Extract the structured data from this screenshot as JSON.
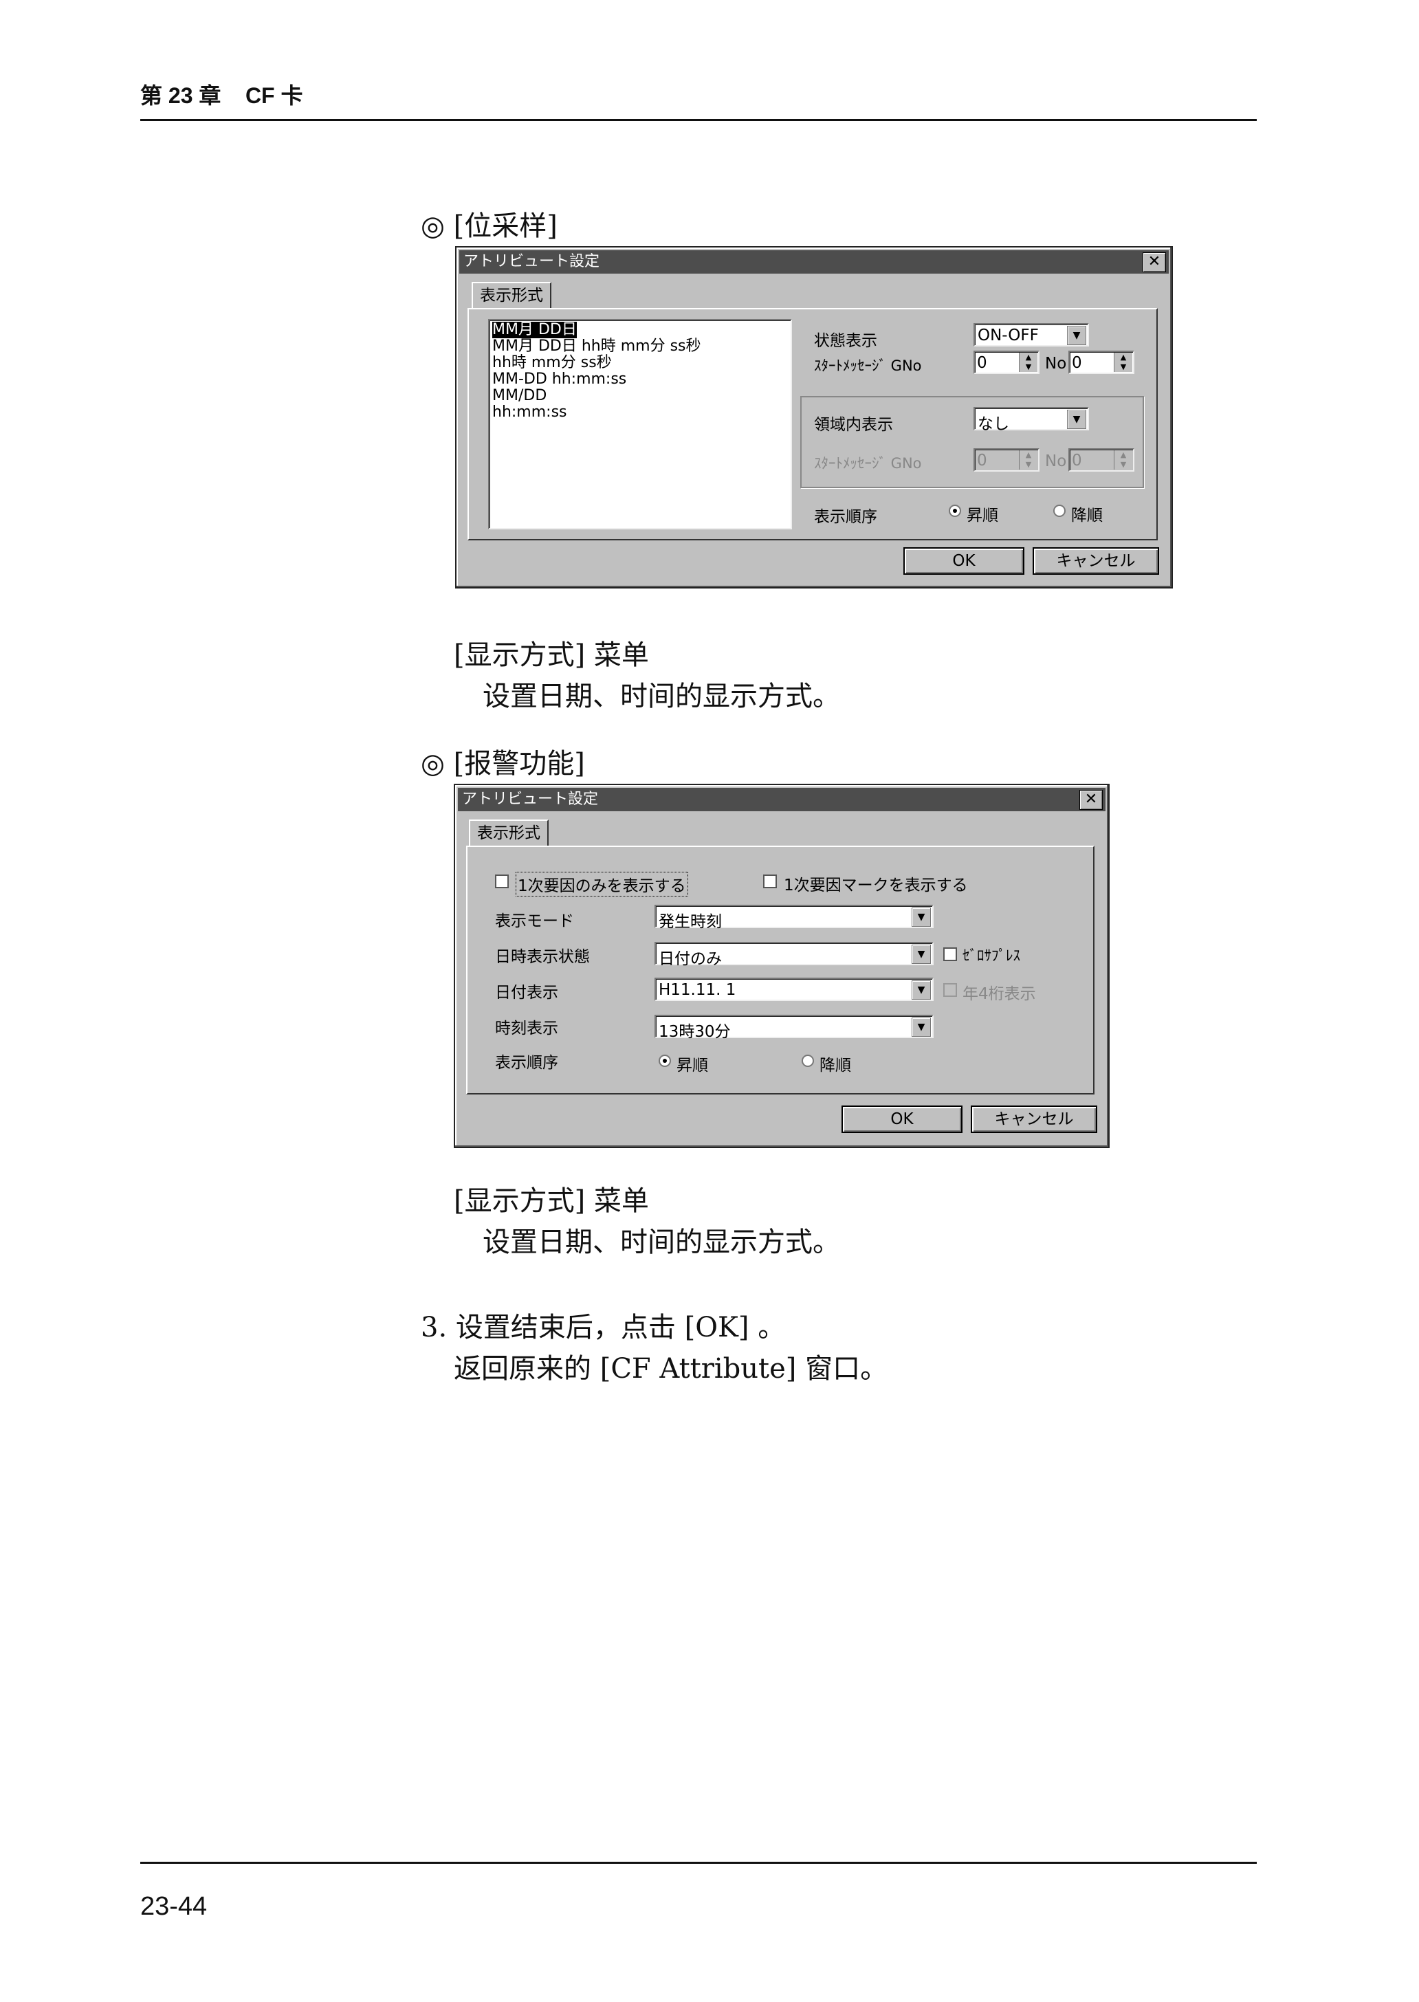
{
  "header": {
    "title": "第 23 章    CF 卡"
  },
  "footer": {
    "page_number": "23-44"
  },
  "section1": {
    "heading": "◎ [位采样]",
    "menu_title": "[显示方式] 菜单",
    "menu_desc": "设置日期、时间的显示方式。"
  },
  "section2": {
    "heading": "◎ [报警功能]",
    "menu_title": "[显示方式] 菜单",
    "menu_desc": "设置日期、时间的显示方式。"
  },
  "steps": {
    "step3": "3. 设置结束后，点击 [OK] 。",
    "step3_result": "返回原来的 [CF Attribute] 窗口。"
  },
  "dialog1": {
    "title": "アトリビュート設定",
    "tab": "表示形式",
    "list_items": [
      "MM月 DD日",
      "MM月 DD日 hh時 mm分 ss秒",
      "hh時 mm分 ss秒",
      "MM-DD hh:mm:ss",
      "MM/DD",
      "hh:mm:ss"
    ],
    "status_label": "状態表示",
    "status_value": "ON-OFF",
    "start_msg_label": "ｽﾀｰﾄﾒｯｾｰｼﾞ GNo",
    "gno_value": "0",
    "no_label": "No",
    "no_value": "0",
    "region_label": "領域内表示",
    "region_value": "なし",
    "start_msg_label2": "ｽﾀｰﾄﾒｯｾｰｼﾞ GNo",
    "gno_value2": "0",
    "no_label2": "No",
    "no_value2": "0",
    "order_label": "表示順序",
    "asc_label": "昇順",
    "desc_label": "降順",
    "ok": "OK",
    "cancel": "キャンセル"
  },
  "dialog2": {
    "title": "アトリビュート設定",
    "tab": "表示形式",
    "check1": "1次要因のみを表示する",
    "check2": "1次要因マークを表示する",
    "mode_label": "表示モード",
    "mode_value": "発生時刻",
    "datetime_label": "日時表示状態",
    "datetime_value": "日付のみ",
    "zero_suppress": "ｾﾞﾛｻﾌﾟﾚｽ",
    "date_label": "日付表示",
    "date_value": "H11.11. 1",
    "year_label": "年4桁表示",
    "time_label": "時刻表示",
    "time_value": "13時30分",
    "order_label": "表示順序",
    "asc_label": "昇順",
    "desc_label": "降順",
    "ok": "OK",
    "cancel": "キャンセル"
  }
}
